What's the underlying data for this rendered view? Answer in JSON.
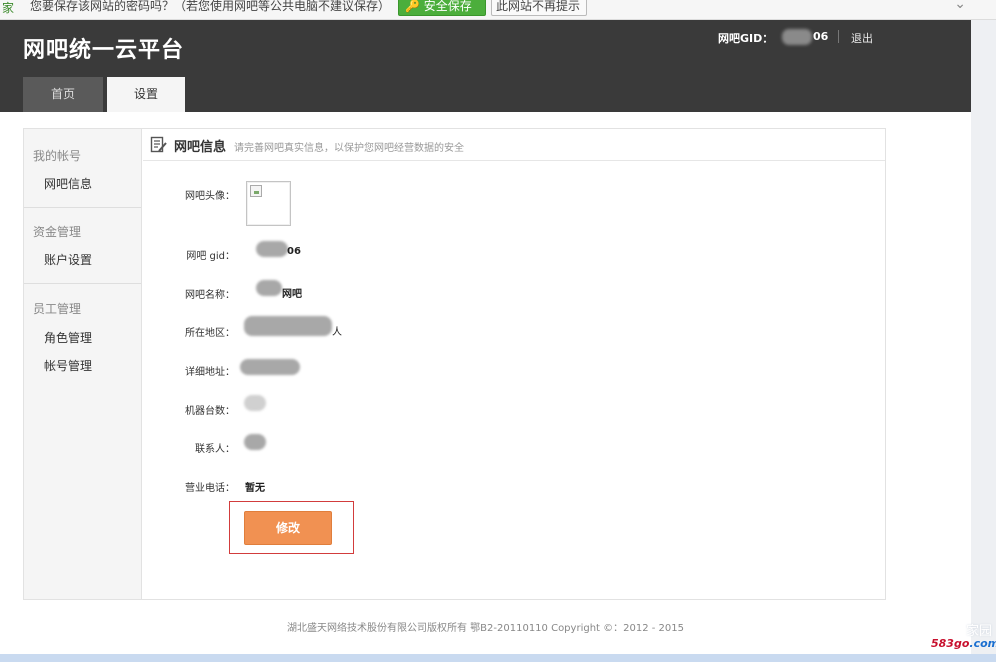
{
  "browser_bar": {
    "lead": "家",
    "message": "您要保存该网站的密码吗？（若您使用网吧等公共电脑不建议保存）",
    "save_button": "安全保存",
    "no_prompt_button": "此网站不再提示",
    "close_glyph": "⌄"
  },
  "header": {
    "logo": "网吧统一云平台",
    "gid_label": "网吧GID：",
    "gid_suffix": "06",
    "logout": "退出",
    "tabs": [
      {
        "label": "首页",
        "active": false
      },
      {
        "label": "设置",
        "active": true
      }
    ]
  },
  "sidebar": {
    "groups": [
      {
        "title": "我的帐号",
        "items": [
          "网吧信息"
        ]
      },
      {
        "title": "资金管理",
        "items": [
          "账户设置"
        ]
      },
      {
        "title": "员工管理",
        "items": [
          "角色管理",
          "帐号管理"
        ]
      }
    ]
  },
  "content": {
    "title": "网吧信息",
    "hint": "请完善网吧真实信息，以保护您网吧经营数据的安全",
    "fields": [
      {
        "label": "网吧头像：",
        "value": ""
      },
      {
        "label": "网吧 gid：",
        "value": "06"
      },
      {
        "label": "网吧名称：",
        "value": "网吧"
      },
      {
        "label": "所在地区：",
        "value": "人"
      },
      {
        "label": "详细地址：",
        "value": ""
      },
      {
        "label": "机器台数：",
        "value": ""
      },
      {
        "label": "联系人：",
        "value": ""
      },
      {
        "label": "营业电话：",
        "value": "暂无"
      }
    ],
    "modify_button": "修改"
  },
  "footer": {
    "copyright": "湖北盛天网络技术股份有限公司版权所有 鄂B2-20110110 Copyright ©：2012 - 2015"
  },
  "watermark": {
    "site_a": "583go",
    "site_b": ".com",
    "cn": "家园"
  },
  "colors": {
    "header_bg": "#3a3a3a",
    "accent_button": "#f19152",
    "highlight_border": "#d23c3c",
    "save_green": "#4cae3c"
  }
}
